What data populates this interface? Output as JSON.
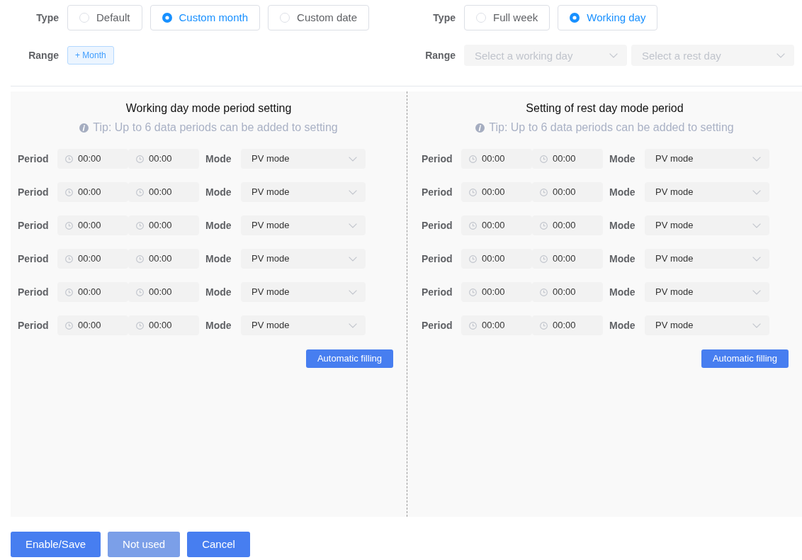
{
  "type_groups": [
    {
      "type_label": "Type",
      "options": [
        {
          "label": "Default",
          "selected": false
        },
        {
          "label": "Custom month",
          "selected": true
        },
        {
          "label": "Custom date",
          "selected": false
        }
      ],
      "range_label": "Range",
      "range": {
        "kind": "add_button",
        "label": "+ Month"
      }
    },
    {
      "type_label": "Type",
      "options": [
        {
          "label": "Full week",
          "selected": false
        },
        {
          "label": "Working day",
          "selected": true
        }
      ],
      "range_label": "Range",
      "range": {
        "kind": "selects",
        "selects": [
          {
            "placeholder": "Select a working day"
          },
          {
            "placeholder": "Select a rest day"
          }
        ]
      }
    }
  ],
  "panels": [
    {
      "title": "Working day mode period setting",
      "tip": "Tip: Up to 6 data periods can be added to setting",
      "rows": [
        {
          "period_label": "Period",
          "start": "00:00",
          "end": "00:00",
          "mode_label": "Mode",
          "mode": "PV mode"
        },
        {
          "period_label": "Period",
          "start": "00:00",
          "end": "00:00",
          "mode_label": "Mode",
          "mode": "PV mode"
        },
        {
          "period_label": "Period",
          "start": "00:00",
          "end": "00:00",
          "mode_label": "Mode",
          "mode": "PV mode"
        },
        {
          "period_label": "Period",
          "start": "00:00",
          "end": "00:00",
          "mode_label": "Mode",
          "mode": "PV mode"
        },
        {
          "period_label": "Period",
          "start": "00:00",
          "end": "00:00",
          "mode_label": "Mode",
          "mode": "PV mode"
        },
        {
          "period_label": "Period",
          "start": "00:00",
          "end": "00:00",
          "mode_label": "Mode",
          "mode": "PV mode"
        }
      ],
      "fill_button": "Automatic filling"
    },
    {
      "title": "Setting of rest day mode period",
      "tip": "Tip: Up to 6 data periods can be added to setting",
      "rows": [
        {
          "period_label": "Period",
          "start": "00:00",
          "end": "00:00",
          "mode_label": "Mode",
          "mode": "PV mode"
        },
        {
          "period_label": "Period",
          "start": "00:00",
          "end": "00:00",
          "mode_label": "Mode",
          "mode": "PV mode"
        },
        {
          "period_label": "Period",
          "start": "00:00",
          "end": "00:00",
          "mode_label": "Mode",
          "mode": "PV mode"
        },
        {
          "period_label": "Period",
          "start": "00:00",
          "end": "00:00",
          "mode_label": "Mode",
          "mode": "PV mode"
        },
        {
          "period_label": "Period",
          "start": "00:00",
          "end": "00:00",
          "mode_label": "Mode",
          "mode": "PV mode"
        },
        {
          "period_label": "Period",
          "start": "00:00",
          "end": "00:00",
          "mode_label": "Mode",
          "mode": "PV mode"
        }
      ],
      "fill_button": "Automatic filling"
    }
  ],
  "footer_buttons": [
    {
      "label": "Enable/Save",
      "disabled": false
    },
    {
      "label": "Not used",
      "disabled": true
    },
    {
      "label": "Cancel",
      "disabled": false
    }
  ]
}
